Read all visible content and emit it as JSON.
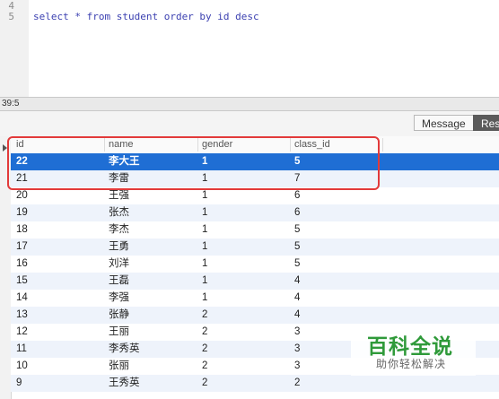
{
  "editor": {
    "line_numbers": [
      "4",
      "5"
    ],
    "code": "select * from student order by id desc"
  },
  "status": {
    "cursor": "39:5"
  },
  "tabs": {
    "message": "Message",
    "result": "Res"
  },
  "grid": {
    "columns": [
      "id",
      "name",
      "gender",
      "class_id"
    ],
    "selected_row_index": 0,
    "rows": [
      [
        "22",
        "李大王",
        "1",
        "5"
      ],
      [
        "21",
        "李雷",
        "1",
        "7"
      ],
      [
        "20",
        "王强",
        "1",
        "6"
      ],
      [
        "19",
        "张杰",
        "1",
        "6"
      ],
      [
        "18",
        "李杰",
        "1",
        "5"
      ],
      [
        "17",
        "王勇",
        "1",
        "5"
      ],
      [
        "16",
        "刘洋",
        "1",
        "5"
      ],
      [
        "15",
        "王磊",
        "1",
        "4"
      ],
      [
        "14",
        "李强",
        "1",
        "4"
      ],
      [
        "13",
        "张静",
        "2",
        "4"
      ],
      [
        "12",
        "王丽",
        "2",
        "3"
      ],
      [
        "11",
        "李秀英",
        "2",
        "3"
      ],
      [
        "10",
        "张丽",
        "2",
        "3"
      ],
      [
        "9",
        "王秀英",
        "2",
        "2"
      ]
    ]
  },
  "watermark": {
    "title": "百科全说",
    "subtitle": "助你轻松解决"
  },
  "colors": {
    "selection": "#1f6ed4",
    "annotation": "#e23a3a",
    "watermark": "#2f9a3a"
  }
}
